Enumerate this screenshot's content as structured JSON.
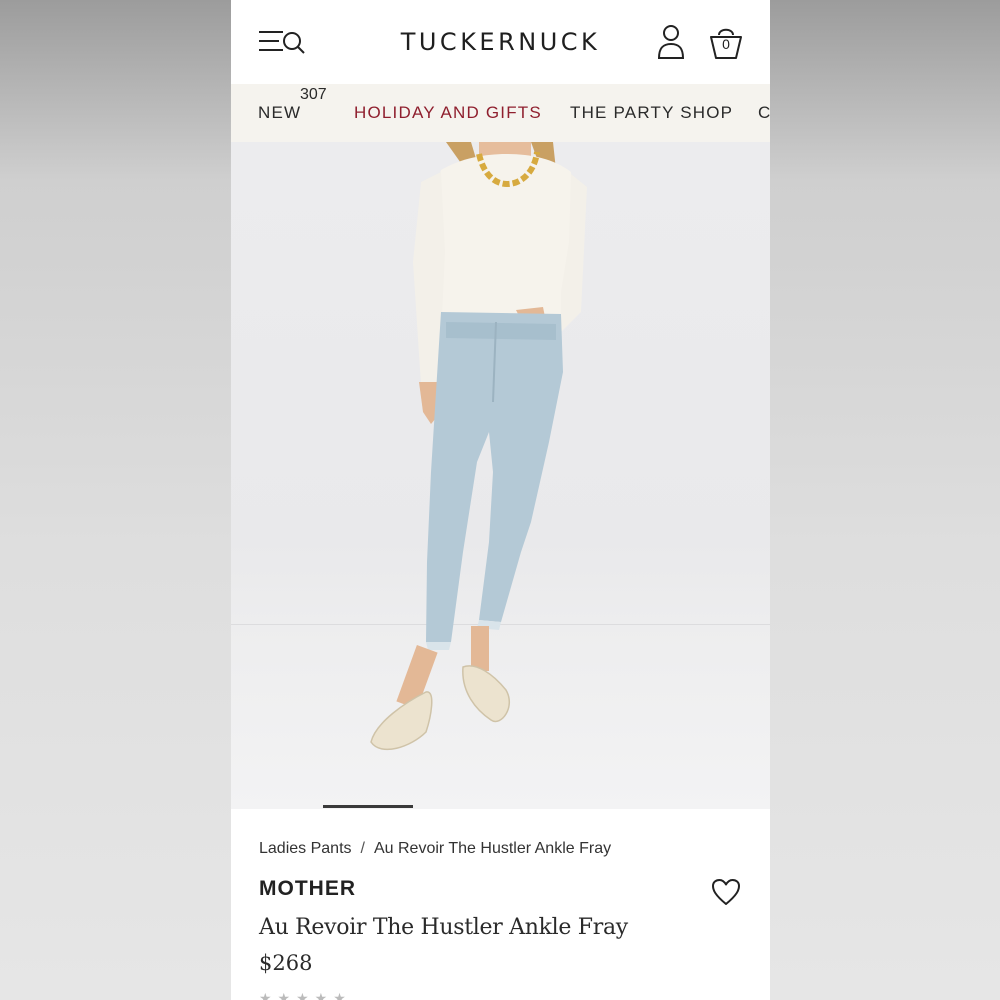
{
  "header": {
    "logo": "TUCKERNUCK",
    "cart_count": "0"
  },
  "nav": {
    "items": [
      {
        "label": "NEW",
        "count": "307"
      },
      {
        "label": "HOLIDAY AND GIFTS"
      },
      {
        "label": "THE PARTY SHOP"
      },
      {
        "label": "C"
      }
    ]
  },
  "carousel": {
    "position_fraction": 0.17
  },
  "product": {
    "breadcrumb": [
      "Ladies Pants",
      "Au Revoir The Hustler Ankle Fray"
    ],
    "breadcrumb_separator": "/",
    "brand": "MOTHER",
    "title": "Au Revoir The Hustler Ankle Fray",
    "price": "$268"
  },
  "colors": {
    "accent": "#8f1f2e",
    "nav_bg": "#f5f3ee"
  },
  "icons": [
    "menu-search-icon",
    "account-icon",
    "bag-icon",
    "heart-icon"
  ]
}
